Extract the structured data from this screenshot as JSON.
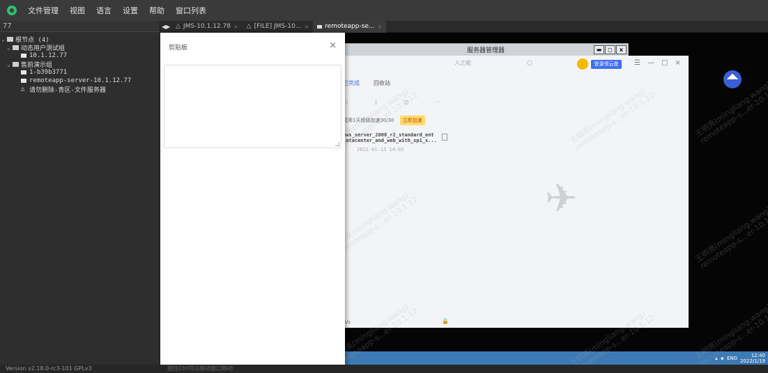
{
  "menubar": {
    "items": [
      "文件管理",
      "视图",
      "语言",
      "设置",
      "帮助",
      "窗口列表"
    ]
  },
  "leftpanel": {
    "header": "77",
    "tree": [
      {
        "label": "根节点 (4)",
        "indent": 0,
        "type": "folder"
      },
      {
        "label": "动态用户测试组",
        "indent": 1,
        "type": "folder"
      },
      {
        "label": "10.1.12.77",
        "indent": 2,
        "type": "host"
      },
      {
        "label": "售前演示组",
        "indent": 1,
        "type": "folder"
      },
      {
        "label": "1-b39b3771",
        "indent": 2,
        "type": "host"
      },
      {
        "label": "remoteapp-server-10.1.12.77",
        "indent": 2,
        "type": "host"
      },
      {
        "label": "请勿删除-青区-文件服务器",
        "indent": 2,
        "type": "warn"
      }
    ]
  },
  "tabs": [
    {
      "label": "JMS-10.1.12.78"
    },
    {
      "label": "[FILE] JMS-10..."
    },
    {
      "label": "remoteapp-se..."
    }
  ],
  "clipboard": {
    "title": "剪贴板",
    "close": "×"
  },
  "remote": {
    "server_manager_title": "服务器管理器",
    "win_btns": [
      "▬",
      "◻",
      "x"
    ],
    "search_placeholder": "入之能",
    "login_button": "登录领云盘",
    "app_tabs": [
      "已完成",
      "回收站"
    ],
    "notice_text": "试用1天超级加速30/30",
    "speed_button": "立即加速",
    "file_name_1": "ows_server_2008_r2_standard_ent",
    "file_name_2": "latacenter_and_web_with_sp1_x...",
    "file_date": "2022-01-13 14:05",
    "speed_text": "B/s",
    "taskbar": {
      "lang": "ENG",
      "time": "12:40",
      "date": "2022/1/19"
    },
    "watermark": "王明亮(mingliang.wang)\nremoteapp-s...er-10.1.12."
  },
  "statusbar": {
    "version": "Version v2.18.0-rc3-101 GPLv3",
    "hint": "按住Ctrl可以拖动窗口移动"
  }
}
